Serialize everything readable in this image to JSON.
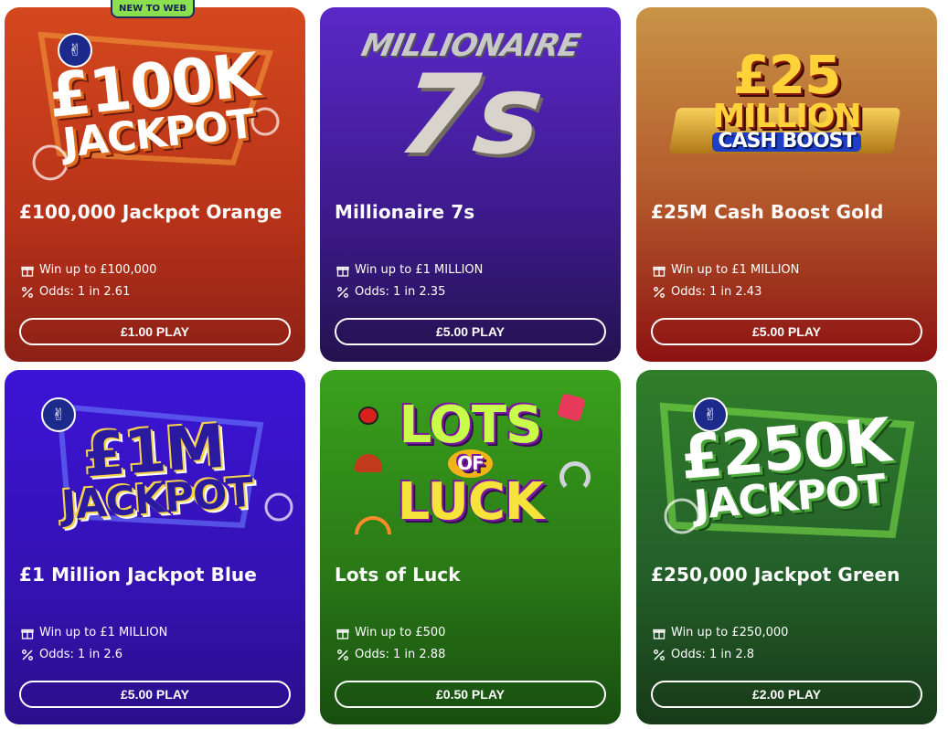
{
  "badge": "NEW TO WEB",
  "cards": [
    {
      "art_line1": "£100K",
      "art_line2": "JACKPOT",
      "title": "£100,000 Jackpot Orange",
      "prize": "Win up to £100,000",
      "odds": "Odds: 1 in 2.61",
      "play": "£1.00 PLAY",
      "colors": {
        "top": "#d4481e",
        "bottom": "#8c2016"
      }
    },
    {
      "art_line1": "MILLIONAIRE",
      "art_line2": "7s",
      "title": "Millionaire 7s",
      "prize": "Win up to £1 MILLION",
      "odds": "Odds: 1 in 2.35",
      "play": "£5.00 PLAY",
      "colors": {
        "top": "#5a28c8",
        "bottom": "#24124e"
      }
    },
    {
      "art_line1": "£25",
      "art_line2": "MILLION",
      "art_line3": "CASH BOOST",
      "title": "£25M Cash Boost Gold",
      "prize": "Win up to £1 MILLION",
      "odds": "Odds: 1 in 2.43",
      "play": "£5.00 PLAY",
      "colors": {
        "top": "#c89446",
        "bottom": "#8c1212"
      }
    },
    {
      "art_line1": "£1M",
      "art_line2": "JACKPOT",
      "title": "£1 Million Jackpot Blue",
      "prize": "Win up to £1 MILLION",
      "odds": "Odds: 1 in 2.6",
      "play": "£5.00 PLAY",
      "colors": {
        "top": "#3c14d6",
        "bottom": "#2a0f8a"
      }
    },
    {
      "art_line1": "LOTS",
      "art_line2": "OF",
      "art_line3": "LUCK",
      "title": "Lots of Luck",
      "prize": "Win up to £500",
      "odds": "Odds: 1 in 2.88",
      "play": "£0.50 PLAY",
      "colors": {
        "top": "#3aa21c",
        "bottom": "#184e10"
      }
    },
    {
      "art_line1": "£250K",
      "art_line2": "JACKPOT",
      "title": "£250,000 Jackpot Green",
      "prize": "Win up to £250,000",
      "odds": "Odds: 1 in 2.8",
      "play": "£2.00 PLAY",
      "colors": {
        "top": "#2f7e2a",
        "bottom": "#183a18"
      }
    }
  ]
}
